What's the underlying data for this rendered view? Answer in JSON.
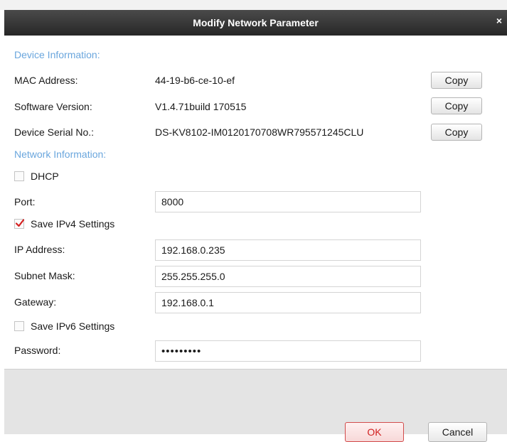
{
  "dialog": {
    "title": "Modify Network Parameter",
    "close_glyph": "×"
  },
  "device_info": {
    "heading": "Device Information:",
    "rows": [
      {
        "label": "MAC Address:",
        "value": "44-19-b6-ce-10-ef",
        "button": "Copy"
      },
      {
        "label": "Software Version:",
        "value": "V1.4.71build 170515",
        "button": "Copy"
      },
      {
        "label": "Device Serial No.:",
        "value": "DS-KV8102-IM0120170708WR795571245CLU",
        "button": "Copy"
      }
    ]
  },
  "network_info": {
    "heading": "Network Information:",
    "dhcp": {
      "label": "DHCP",
      "checked": false
    },
    "port": {
      "label": "Port:",
      "value": "8000"
    },
    "ipv4": {
      "label": "Save IPv4 Settings",
      "checked": true
    },
    "ip_address": {
      "label": "IP Address:",
      "value": "192.168.0.235"
    },
    "subnet_mask": {
      "label": "Subnet Mask:",
      "value": "255.255.255.0"
    },
    "gateway": {
      "label": "Gateway:",
      "value": "192.168.0.1"
    },
    "ipv6": {
      "label": "Save IPv6 Settings",
      "checked": false
    },
    "password": {
      "label": "Password:",
      "value": "•••••••••"
    }
  },
  "footer": {
    "ok_label": "OK",
    "cancel_label": "Cancel"
  },
  "colors": {
    "section_heading": "#6aa6dd",
    "titlebar": "#333333",
    "ok_border": "#d24c4c",
    "checkmark": "#d42020"
  }
}
